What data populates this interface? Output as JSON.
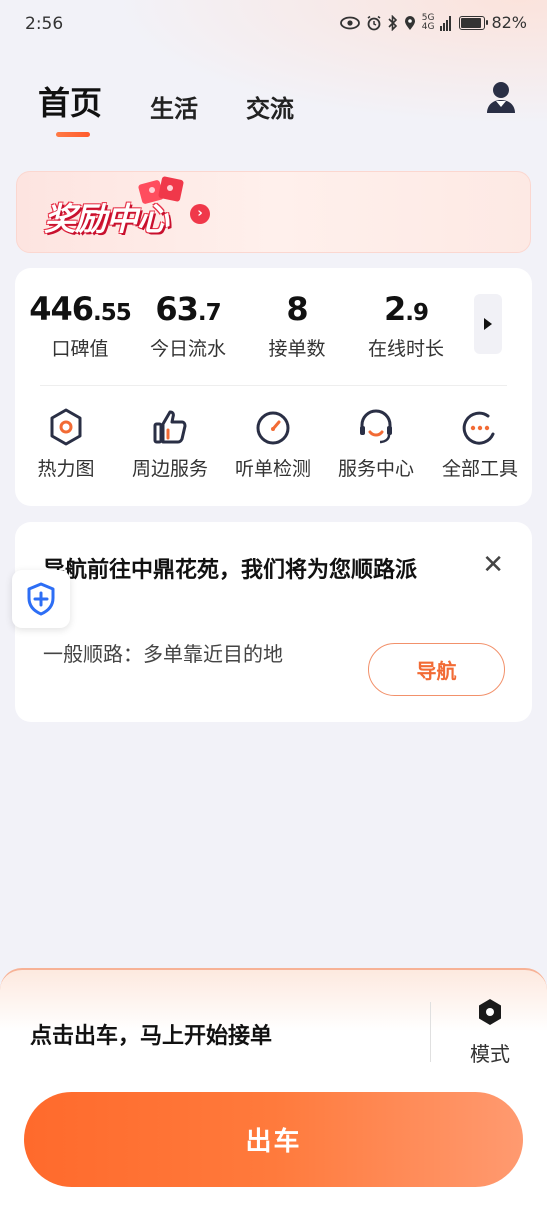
{
  "status_bar": {
    "time": "2:56",
    "battery": "82%",
    "network": "5G"
  },
  "tabs": [
    {
      "label": "首页",
      "active": true
    },
    {
      "label": "生活",
      "active": false
    },
    {
      "label": "交流",
      "active": false
    }
  ],
  "reward": {
    "title": "奖励中心",
    "arrow": "›"
  },
  "stats": [
    {
      "main": "446",
      "decimal": ".55",
      "label": "口碑值"
    },
    {
      "main": "63",
      "decimal": ".7",
      "label": "今日流水"
    },
    {
      "main": "8",
      "decimal": "",
      "label": "接单数"
    },
    {
      "main": "2",
      "decimal": ".9",
      "label": "在线时长"
    }
  ],
  "tools": [
    {
      "label": "热力图",
      "icon": "heatmap-icon"
    },
    {
      "label": "周边服务",
      "icon": "thumbs-up-icon"
    },
    {
      "label": "听单检测",
      "icon": "gauge-icon"
    },
    {
      "label": "服务中心",
      "icon": "headset-icon"
    },
    {
      "label": "全部工具",
      "icon": "more-dots-icon"
    }
  ],
  "nav_card": {
    "title": "导航前往中鼎花苑，我们将为您顺路派",
    "subtitle": "一般顺路：多单靠近目的地",
    "button": "导航",
    "close": "✕"
  },
  "bottom": {
    "prompt": "点击出车，马上开始接单",
    "mode_label": "模式",
    "go_button": "出车"
  },
  "colors": {
    "accent": "#ff6a2c",
    "icon_orange": "#f26b35",
    "icon_dark": "#2a2f45"
  }
}
